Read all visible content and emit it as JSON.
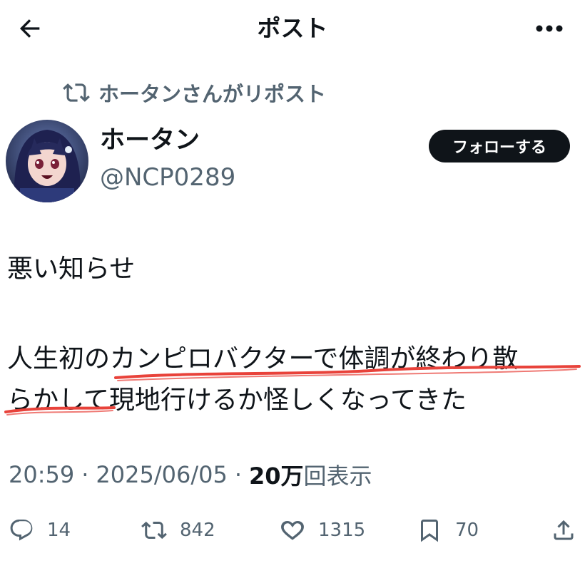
{
  "header": {
    "title": "ポスト",
    "back_icon": "arrow-left-icon",
    "more_icon": "more-horizontal-icon"
  },
  "repost_context": {
    "text": "ホータンさんがリポスト",
    "icon": "repost-icon"
  },
  "author": {
    "name": "ホータン",
    "handle": "@NCP0289",
    "follow_label": "フォローする"
  },
  "post": {
    "lines": [
      "悪い知らせ",
      "",
      "人生初のカンピロバクターで体調が終わり散",
      "らかして現地行けるか怪しくなってきた"
    ]
  },
  "meta": {
    "time": "20:59",
    "separator": "·",
    "date": "2025/06/05",
    "views_count": "20万",
    "views_label": "回表示"
  },
  "actions": {
    "replies": "14",
    "reposts": "842",
    "likes": "1315",
    "bookmarks": "70"
  },
  "colors": {
    "text": "#0f1419",
    "secondary": "#536471",
    "underline": "#e8423a",
    "button_bg": "#0f1419"
  }
}
